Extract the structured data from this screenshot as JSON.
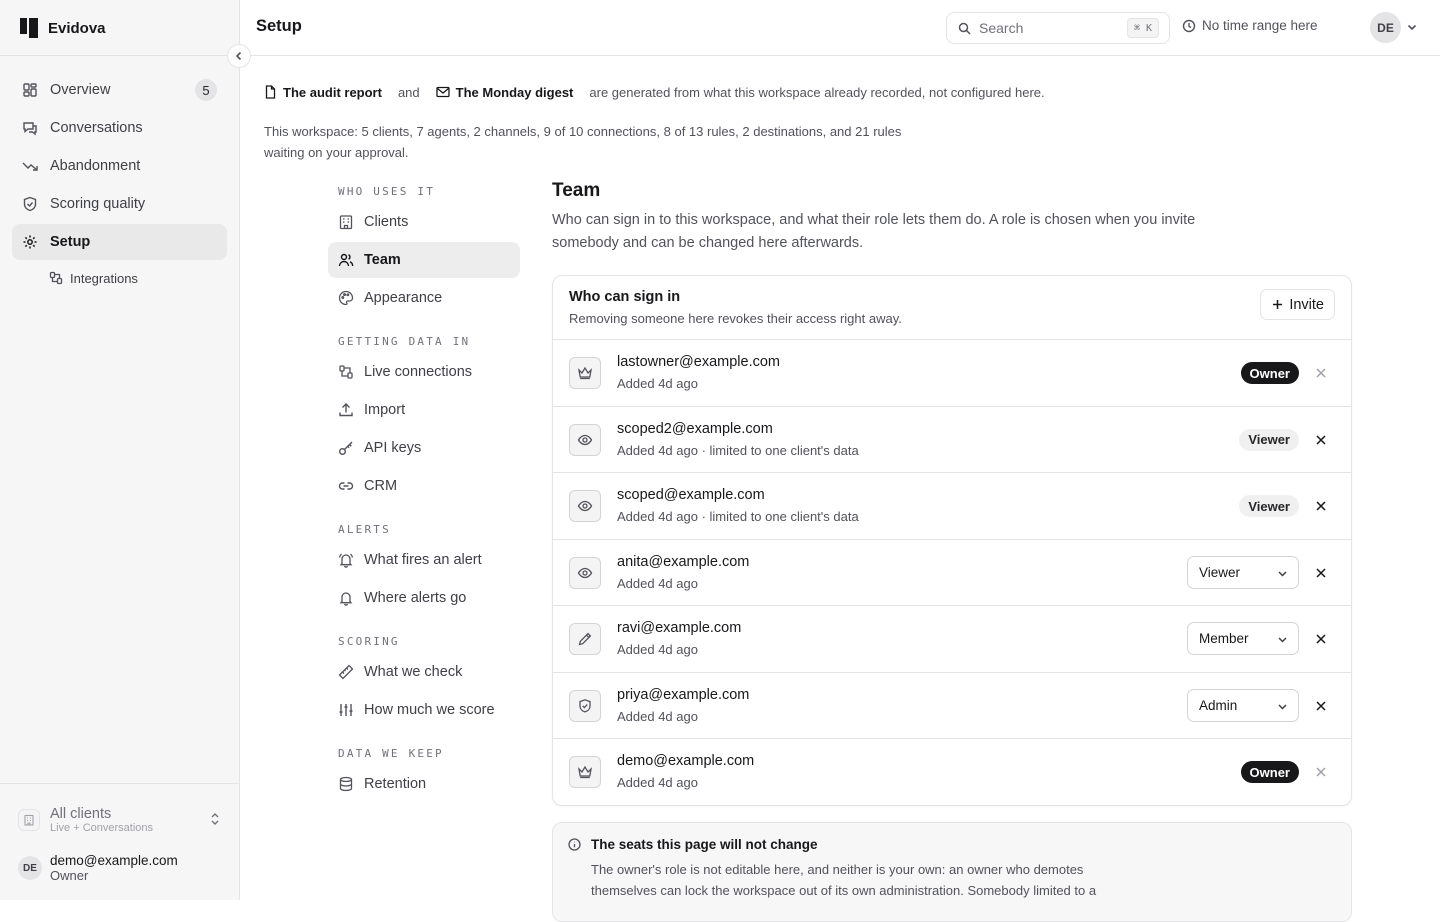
{
  "brand": {
    "name": "Evidova"
  },
  "sidebar": {
    "items": [
      {
        "label": "Overview",
        "icon": "grid-icon",
        "badge": "5"
      },
      {
        "label": "Conversations",
        "icon": "chat-icon"
      },
      {
        "label": "Abandonment",
        "icon": "trend-down-icon"
      },
      {
        "label": "Scoring quality",
        "icon": "shield-check-icon"
      },
      {
        "label": "Setup",
        "icon": "gear-icon",
        "active": true
      }
    ],
    "sub_items": [
      {
        "label": "Integrations",
        "icon": "integrations-icon"
      }
    ],
    "client_switch": {
      "title": "All clients",
      "subtitle": "Live + Conversations"
    },
    "user": {
      "initials": "DE",
      "email": "demo@example.com",
      "role": "Owner"
    }
  },
  "topbar": {
    "title": "Setup",
    "search_label": "Search",
    "search_shortcut": "⌘ K",
    "time_range": "No time range here",
    "avatar_initials": "DE"
  },
  "notice": {
    "doc1": "The audit report",
    "and": "and",
    "doc2": "The Monday digest",
    "tail": "are generated from what this workspace already recorded, not configured here."
  },
  "summary": "This workspace: 5 clients, 7 agents, 2 channels, 9 of 10 connections, 8 of 13 rules, 2 destinations, and 21 rules waiting on your approval.",
  "subnav": {
    "sections": [
      {
        "heading": "WHO USES IT",
        "items": [
          {
            "label": "Clients",
            "icon": "building-icon"
          },
          {
            "label": "Team",
            "icon": "users-icon",
            "active": true
          },
          {
            "label": "Appearance",
            "icon": "palette-icon"
          }
        ]
      },
      {
        "heading": "GETTING DATA IN",
        "items": [
          {
            "label": "Live connections",
            "icon": "plug-icon"
          },
          {
            "label": "Import",
            "icon": "upload-icon"
          },
          {
            "label": "API keys",
            "icon": "key-icon"
          },
          {
            "label": "CRM",
            "icon": "link-icon"
          }
        ]
      },
      {
        "heading": "ALERTS",
        "items": [
          {
            "label": "What fires an alert",
            "icon": "bell-ring-icon"
          },
          {
            "label": "Where alerts go",
            "icon": "bell-icon"
          }
        ]
      },
      {
        "heading": "SCORING",
        "items": [
          {
            "label": "What we check",
            "icon": "ruler-icon"
          },
          {
            "label": "How much we score",
            "icon": "sliders-icon"
          }
        ]
      },
      {
        "heading": "DATA WE KEEP",
        "items": [
          {
            "label": "Retention",
            "icon": "database-icon"
          }
        ]
      }
    ]
  },
  "team": {
    "title": "Team",
    "description": "Who can sign in to this workspace, and what their role lets them do. A role is chosen when you invite somebody and can be changed here afterwards.",
    "card_title": "Who can sign in",
    "card_subtitle": "Removing someone here revokes their access right away.",
    "invite_label": "Invite",
    "members": [
      {
        "email": "lastowner@example.com",
        "meta": "Added 4d ago",
        "role": "Owner",
        "control": "pill-owner",
        "icon": "crown-icon",
        "removable": false
      },
      {
        "email": "scoped2@example.com",
        "meta": "Added 4d ago · limited to one client's data",
        "role": "Viewer",
        "control": "pill-viewer",
        "icon": "eye-icon",
        "removable": true
      },
      {
        "email": "scoped@example.com",
        "meta": "Added 4d ago · limited to one client's data",
        "role": "Viewer",
        "control": "pill-viewer",
        "icon": "eye-icon",
        "removable": true
      },
      {
        "email": "anita@example.com",
        "meta": "Added 4d ago",
        "role": "Viewer",
        "control": "select",
        "icon": "eye-icon",
        "removable": true
      },
      {
        "email": "ravi@example.com",
        "meta": "Added 4d ago",
        "role": "Member",
        "control": "select",
        "icon": "pencil-icon",
        "removable": true
      },
      {
        "email": "priya@example.com",
        "meta": "Added 4d ago",
        "role": "Admin",
        "control": "select",
        "icon": "shield-icon",
        "removable": true
      },
      {
        "email": "demo@example.com",
        "meta": "Added 4d ago",
        "role": "Owner",
        "control": "pill-owner",
        "icon": "crown-icon",
        "removable": false
      }
    ]
  },
  "seats_note": {
    "title": "The seats this page will not change",
    "body": "The owner's role is not editable here, and neither is your own: an owner who demotes themselves can lock the workspace out of its own administration. Somebody limited to a"
  },
  "colors": {
    "accent_dark": "#18181b",
    "muted_text": "#52525b",
    "border": "#e4e4e7",
    "sidebar_bg": "#f6f6f6"
  }
}
